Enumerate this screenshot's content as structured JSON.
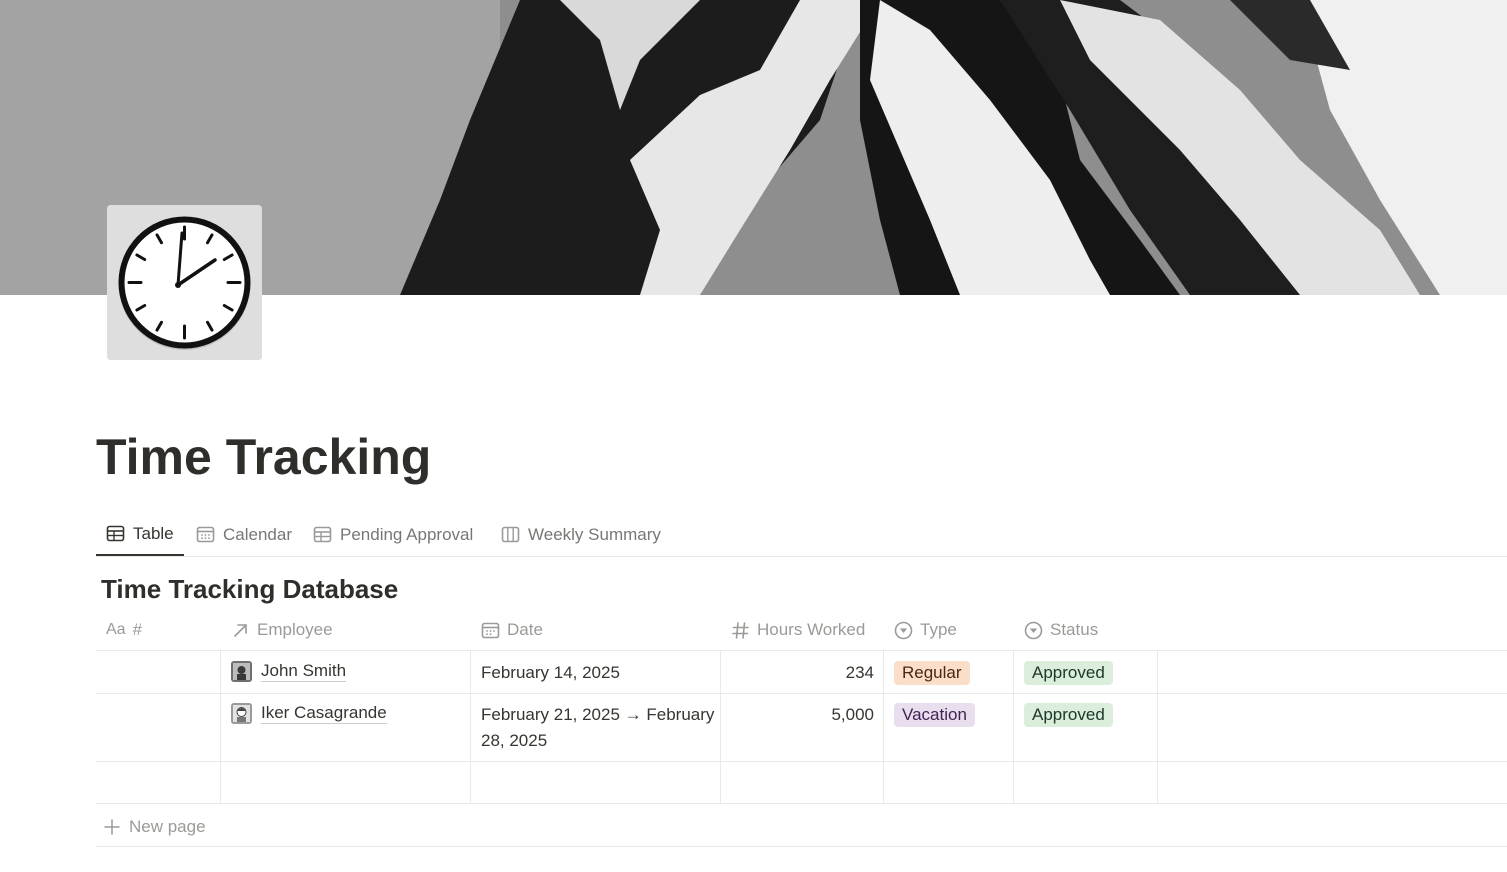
{
  "page": {
    "title": "Time Tracking",
    "icon": "clock-icon",
    "cover": "mountain-cover-image"
  },
  "views": [
    {
      "label": "Table",
      "icon": "table-icon",
      "active": true
    },
    {
      "label": "Calendar",
      "icon": "calendar-icon",
      "active": false
    },
    {
      "label": "Pending Approval",
      "icon": "table-icon",
      "active": false
    },
    {
      "label": "Weekly Summary",
      "icon": "board-icon",
      "active": false
    }
  ],
  "database": {
    "title": "Time Tracking Database",
    "columns": [
      {
        "label": "#",
        "icon_text": "Aa",
        "icon": "title-icon"
      },
      {
        "label": "Employee",
        "icon": "relation-arrow-icon"
      },
      {
        "label": "Date",
        "icon": "calendar-icon"
      },
      {
        "label": "Hours Worked",
        "icon": "number-hash-icon"
      },
      {
        "label": "Type",
        "icon": "select-icon"
      },
      {
        "label": "Status",
        "icon": "select-icon"
      }
    ],
    "rows": [
      {
        "id": "",
        "employee": "John Smith",
        "date": "February 14, 2025",
        "hours": "234",
        "type": {
          "label": "Regular",
          "bg": "#fadec9",
          "fg": "#49290e"
        },
        "status": {
          "label": "Approved",
          "bg": "#dbeddb",
          "fg": "#1c3829"
        }
      },
      {
        "id": "",
        "employee": "Iker Casagrande",
        "date_line1": "February 21, 2025 → February",
        "date_line2": "28, 2025",
        "hours": "5,000",
        "type": {
          "label": "Vacation",
          "bg": "#e8deee",
          "fg": "#412454"
        },
        "status": {
          "label": "Approved",
          "bg": "#dbeddb",
          "fg": "#1c3829"
        }
      }
    ],
    "new_page_label": "New page"
  }
}
